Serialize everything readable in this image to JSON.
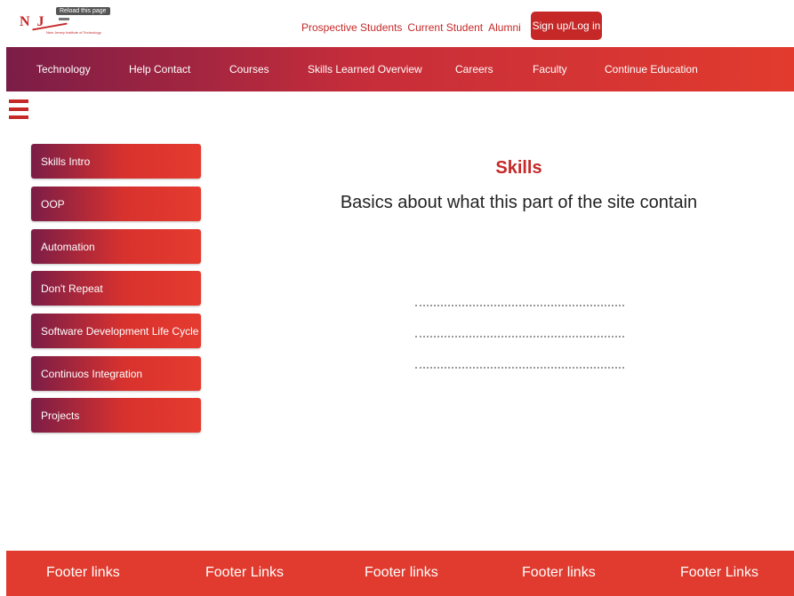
{
  "header": {
    "logo_letters": "N J",
    "logo_subtitle": "New Jersey Institute of Technology",
    "tooltip": "Reload this page",
    "links": [
      "Prospective Students",
      "Current Student",
      "Alumni"
    ],
    "signup_label": "Sign up/Log in"
  },
  "nav": {
    "items": [
      "Technology",
      "Help Contact",
      "Courses",
      "Skills Learned Overview",
      "Careers",
      "Faculty",
      "Continue Education"
    ]
  },
  "sidebar": {
    "menu_icon": "hamburger-icon",
    "items": [
      "Skills Intro",
      "OOP",
      "Automation",
      "Don't Repeat",
      "Software Development Life Cycle",
      "Continuos Integration",
      "Projects"
    ]
  },
  "main": {
    "title": "Skills",
    "subtitle": "Basics about what this part of the site contain"
  },
  "footer": {
    "links": [
      "Footer links",
      "Footer Links",
      "Footer links",
      "Footer links",
      "Footer Links"
    ]
  },
  "colors": {
    "brand_red": "#c62828",
    "gradient_start": "#7b1d47",
    "gradient_end": "#e53b2f",
    "footer_red": "#e03b2e"
  }
}
